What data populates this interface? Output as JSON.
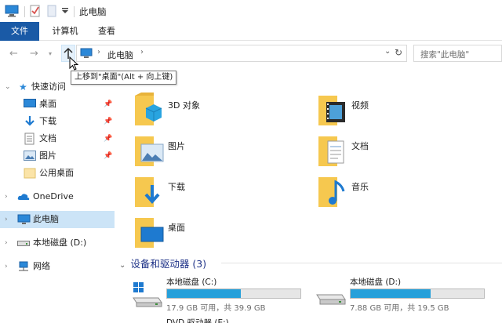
{
  "window": {
    "title": "此电脑"
  },
  "ribbon": {
    "file_tab": "文件",
    "computer_tab": "计算机",
    "view_tab": "查看"
  },
  "address": {
    "path_segment": "此电脑",
    "search_placeholder": "搜索\"此电脑\""
  },
  "tooltip": "上移到\"桌面\"(Alt + 向上键)",
  "sidebar": {
    "quick_access": "快速访问",
    "quick_items": [
      {
        "label": "桌面",
        "icon": "desktop-icon",
        "pinned": true
      },
      {
        "label": "下载",
        "icon": "download-icon",
        "pinned": true
      },
      {
        "label": "文档",
        "icon": "documents-icon",
        "pinned": true
      },
      {
        "label": "图片",
        "icon": "pictures-icon",
        "pinned": true
      },
      {
        "label": "公用桌面",
        "icon": "folder-icon",
        "pinned": false
      }
    ],
    "onedrive": "OneDrive",
    "this_pc": "此电脑",
    "local_disk": "本地磁盘 (D:)",
    "network": "网络"
  },
  "folders": [
    {
      "label": "3D 对象",
      "icon": "3d-objects-icon"
    },
    {
      "label": "视频",
      "icon": "videos-icon"
    },
    {
      "label": "图片",
      "icon": "pictures-icon"
    },
    {
      "label": "文档",
      "icon": "documents-icon"
    },
    {
      "label": "下载",
      "icon": "downloads-icon"
    },
    {
      "label": "音乐",
      "icon": "music-icon"
    },
    {
      "label": "桌面",
      "icon": "desktop-icon"
    }
  ],
  "devices_section": "设备和驱动器 (3)",
  "drives": [
    {
      "label": "本地磁盘 (C:)",
      "space": "17.9 GB 可用，共 39.9 GB",
      "used_fraction": 0.55
    },
    {
      "label": "本地磁盘 (D:)",
      "space": "7.88 GB 可用，共 19.5 GB",
      "used_fraction": 0.6
    }
  ],
  "dvd_partial": "DVD 驱动器 (E:)",
  "colors": {
    "accent": "#1a5aa6",
    "selection": "#cce4f7",
    "drive_fill": "#26a0da",
    "folder": "#f6c84f"
  }
}
